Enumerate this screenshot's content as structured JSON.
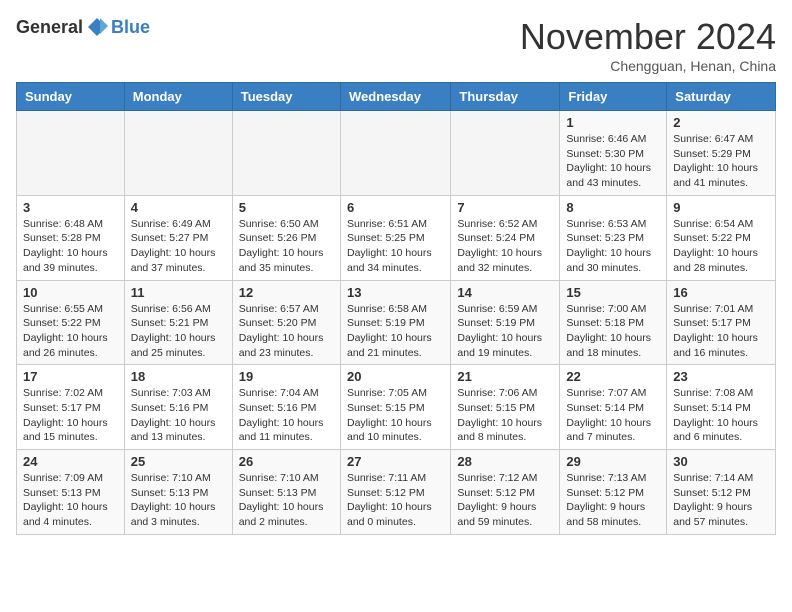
{
  "header": {
    "logo_general": "General",
    "logo_blue": "Blue",
    "month_title": "November 2024",
    "location": "Chengguan, Henan, China"
  },
  "weekdays": [
    "Sunday",
    "Monday",
    "Tuesday",
    "Wednesday",
    "Thursday",
    "Friday",
    "Saturday"
  ],
  "weeks": [
    [
      {
        "day": "",
        "info": "",
        "empty": true
      },
      {
        "day": "",
        "info": "",
        "empty": true
      },
      {
        "day": "",
        "info": "",
        "empty": true
      },
      {
        "day": "",
        "info": "",
        "empty": true
      },
      {
        "day": "",
        "info": "",
        "empty": true
      },
      {
        "day": "1",
        "info": "Sunrise: 6:46 AM\nSunset: 5:30 PM\nDaylight: 10 hours\nand 43 minutes."
      },
      {
        "day": "2",
        "info": "Sunrise: 6:47 AM\nSunset: 5:29 PM\nDaylight: 10 hours\nand 41 minutes."
      }
    ],
    [
      {
        "day": "3",
        "info": "Sunrise: 6:48 AM\nSunset: 5:28 PM\nDaylight: 10 hours\nand 39 minutes."
      },
      {
        "day": "4",
        "info": "Sunrise: 6:49 AM\nSunset: 5:27 PM\nDaylight: 10 hours\nand 37 minutes."
      },
      {
        "day": "5",
        "info": "Sunrise: 6:50 AM\nSunset: 5:26 PM\nDaylight: 10 hours\nand 35 minutes."
      },
      {
        "day": "6",
        "info": "Sunrise: 6:51 AM\nSunset: 5:25 PM\nDaylight: 10 hours\nand 34 minutes."
      },
      {
        "day": "7",
        "info": "Sunrise: 6:52 AM\nSunset: 5:24 PM\nDaylight: 10 hours\nand 32 minutes."
      },
      {
        "day": "8",
        "info": "Sunrise: 6:53 AM\nSunset: 5:23 PM\nDaylight: 10 hours\nand 30 minutes."
      },
      {
        "day": "9",
        "info": "Sunrise: 6:54 AM\nSunset: 5:22 PM\nDaylight: 10 hours\nand 28 minutes."
      }
    ],
    [
      {
        "day": "10",
        "info": "Sunrise: 6:55 AM\nSunset: 5:22 PM\nDaylight: 10 hours\nand 26 minutes."
      },
      {
        "day": "11",
        "info": "Sunrise: 6:56 AM\nSunset: 5:21 PM\nDaylight: 10 hours\nand 25 minutes."
      },
      {
        "day": "12",
        "info": "Sunrise: 6:57 AM\nSunset: 5:20 PM\nDaylight: 10 hours\nand 23 minutes."
      },
      {
        "day": "13",
        "info": "Sunrise: 6:58 AM\nSunset: 5:19 PM\nDaylight: 10 hours\nand 21 minutes."
      },
      {
        "day": "14",
        "info": "Sunrise: 6:59 AM\nSunset: 5:19 PM\nDaylight: 10 hours\nand 19 minutes."
      },
      {
        "day": "15",
        "info": "Sunrise: 7:00 AM\nSunset: 5:18 PM\nDaylight: 10 hours\nand 18 minutes."
      },
      {
        "day": "16",
        "info": "Sunrise: 7:01 AM\nSunset: 5:17 PM\nDaylight: 10 hours\nand 16 minutes."
      }
    ],
    [
      {
        "day": "17",
        "info": "Sunrise: 7:02 AM\nSunset: 5:17 PM\nDaylight: 10 hours\nand 15 minutes."
      },
      {
        "day": "18",
        "info": "Sunrise: 7:03 AM\nSunset: 5:16 PM\nDaylight: 10 hours\nand 13 minutes."
      },
      {
        "day": "19",
        "info": "Sunrise: 7:04 AM\nSunset: 5:16 PM\nDaylight: 10 hours\nand 11 minutes."
      },
      {
        "day": "20",
        "info": "Sunrise: 7:05 AM\nSunset: 5:15 PM\nDaylight: 10 hours\nand 10 minutes."
      },
      {
        "day": "21",
        "info": "Sunrise: 7:06 AM\nSunset: 5:15 PM\nDaylight: 10 hours\nand 8 minutes."
      },
      {
        "day": "22",
        "info": "Sunrise: 7:07 AM\nSunset: 5:14 PM\nDaylight: 10 hours\nand 7 minutes."
      },
      {
        "day": "23",
        "info": "Sunrise: 7:08 AM\nSunset: 5:14 PM\nDaylight: 10 hours\nand 6 minutes."
      }
    ],
    [
      {
        "day": "24",
        "info": "Sunrise: 7:09 AM\nSunset: 5:13 PM\nDaylight: 10 hours\nand 4 minutes."
      },
      {
        "day": "25",
        "info": "Sunrise: 7:10 AM\nSunset: 5:13 PM\nDaylight: 10 hours\nand 3 minutes."
      },
      {
        "day": "26",
        "info": "Sunrise: 7:10 AM\nSunset: 5:13 PM\nDaylight: 10 hours\nand 2 minutes."
      },
      {
        "day": "27",
        "info": "Sunrise: 7:11 AM\nSunset: 5:12 PM\nDaylight: 10 hours\nand 0 minutes."
      },
      {
        "day": "28",
        "info": "Sunrise: 7:12 AM\nSunset: 5:12 PM\nDaylight: 9 hours\nand 59 minutes."
      },
      {
        "day": "29",
        "info": "Sunrise: 7:13 AM\nSunset: 5:12 PM\nDaylight: 9 hours\nand 58 minutes."
      },
      {
        "day": "30",
        "info": "Sunrise: 7:14 AM\nSunset: 5:12 PM\nDaylight: 9 hours\nand 57 minutes."
      }
    ]
  ]
}
